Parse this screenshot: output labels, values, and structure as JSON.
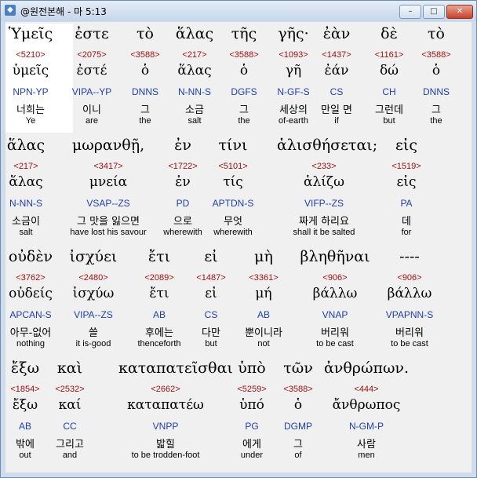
{
  "window": {
    "title": "@원전본해 - 마 5:13",
    "buttons": {
      "minimize": "–",
      "maximize": "□",
      "close": "✕"
    }
  },
  "rows": [
    {
      "words": [
        {
          "greek": "Ὑμεῖς",
          "strong": "<5210>",
          "lemma": "ὑμεῖς",
          "morph": "NPN-YP",
          "korean": "너희는",
          "english": "Ye"
        },
        {
          "greek": "ἐστε",
          "strong": "<2075>",
          "lemma": "ἐστέ",
          "morph": "VIPA--YP",
          "korean": "이니",
          "english": "are"
        },
        {
          "greek": "τὸ",
          "strong": "<3588>",
          "lemma": "ὁ",
          "morph": "DNNS",
          "korean": "그",
          "english": "the"
        },
        {
          "greek": "ἅλας",
          "strong": "<217>",
          "lemma": "ἅλας",
          "morph": "N-NN-S",
          "korean": "소금",
          "english": "salt"
        },
        {
          "greek": "τῆς",
          "strong": "<3588>",
          "lemma": "ὁ",
          "morph": "DGFS",
          "korean": "그",
          "english": "the"
        },
        {
          "greek": "γῆς·",
          "strong": "<1093>",
          "lemma": "γῆ",
          "morph": "N-GF-S",
          "korean": "세상의",
          "english": "of-earth"
        },
        {
          "greek": "ἐὰν",
          "strong": "<1437>",
          "lemma": "ἐάν",
          "morph": "CS",
          "korean": "만일 면",
          "english": "if"
        },
        {
          "greek": "δὲ",
          "strong": "<1161>",
          "lemma": "δώ",
          "morph": "CH",
          "korean": "그런데",
          "english": "but"
        },
        {
          "greek": "τὸ",
          "strong": "<3588>",
          "lemma": "ὁ",
          "morph": "DNNS",
          "korean": "그",
          "english": "the"
        }
      ]
    },
    {
      "words": [
        {
          "greek": "ἅλας",
          "strong": "<217>",
          "lemma": "ἅλας",
          "morph": "N-NN-S",
          "korean": "소금이",
          "english": "salt"
        },
        {
          "greek": "μωρανθῇ,",
          "strong": "<3417>",
          "lemma": "μνεία",
          "morph": "VSAP--ZS",
          "korean": "그 맛을 잃으면",
          "english": "have lost his savour"
        },
        {
          "greek": "ἐν",
          "strong": "<1722>",
          "lemma": "ἐν",
          "morph": "PD",
          "korean": "으로",
          "english": "wherewith"
        },
        {
          "greek": "τίνι",
          "strong": "<5101>",
          "lemma": "τίς",
          "morph": "APTDN-S",
          "korean": "무엇",
          "english": "wherewith"
        },
        {
          "greek": "ἁλισθήσεται;",
          "strong": "<233>",
          "lemma": "ἁλίζω",
          "morph": "VIFP--ZS",
          "korean": "짜게 하리요",
          "english": "shall it be salted"
        },
        {
          "greek": "εἰς",
          "strong": "<1519>",
          "lemma": "εἰς",
          "morph": "PA",
          "korean": "데",
          "english": "for"
        }
      ]
    },
    {
      "words": [
        {
          "greek": "οὐδὲν",
          "strong": "<3762>",
          "lemma": "οὐδείς",
          "morph": "APCAN-S",
          "korean": "아무-없어",
          "english": "nothing"
        },
        {
          "greek": "ἰσχύει",
          "strong": "<2480>",
          "lemma": "ἰσχύω",
          "morph": "VIPA--ZS",
          "korean": "쓸",
          "english": "it is-good"
        },
        {
          "greek": "ἔτι",
          "strong": "<2089>",
          "lemma": "ἔτι",
          "morph": "AB",
          "korean": "후에는",
          "english": "thenceforth"
        },
        {
          "greek": "εἰ",
          "strong": "<1487>",
          "lemma": "εἰ",
          "morph": "CS",
          "korean": "다만",
          "english": "but"
        },
        {
          "greek": "μὴ",
          "strong": "<3361>",
          "lemma": "μή",
          "morph": "AB",
          "korean": "뿐이니라",
          "english": "not"
        },
        {
          "greek": "βληθῆναι",
          "strong": "<906>",
          "lemma": "βάλλω",
          "morph": "VNAP",
          "korean": "버리워",
          "english": "to be cast"
        },
        {
          "greek": "----",
          "strong": "<906>",
          "lemma": "βάλλω",
          "morph": "VPAPNN-S",
          "korean": "버리워",
          "english": "to be cast"
        }
      ]
    },
    {
      "words": [
        {
          "greek": "ἔξω",
          "strong": "<1854>",
          "lemma": "ἔξω",
          "morph": "AB",
          "korean": "밖에",
          "english": "out"
        },
        {
          "greek": "καὶ",
          "strong": "<2532>",
          "lemma": "καί",
          "morph": "CC",
          "korean": "그리고",
          "english": "and"
        },
        {
          "greek": "καταπατεῖσθαι",
          "strong": "<2662>",
          "lemma": "καταπατέω",
          "morph": "VNPP",
          "korean": "밟힐",
          "english": "to be trodden-foot"
        },
        {
          "greek": "ὑπὸ",
          "strong": "<5259>",
          "lemma": "ὑπό",
          "morph": "PG",
          "korean": "에게",
          "english": "under"
        },
        {
          "greek": "τῶν",
          "strong": "<3588>",
          "lemma": "ὁ",
          "morph": "DGMP",
          "korean": "그",
          "english": "of"
        },
        {
          "greek": "ἀνθρώπων.",
          "strong": "<444>",
          "lemma": "ἄνθρωπος",
          "morph": "N-GM-P",
          "korean": "사람",
          "english": "men"
        }
      ]
    }
  ]
}
